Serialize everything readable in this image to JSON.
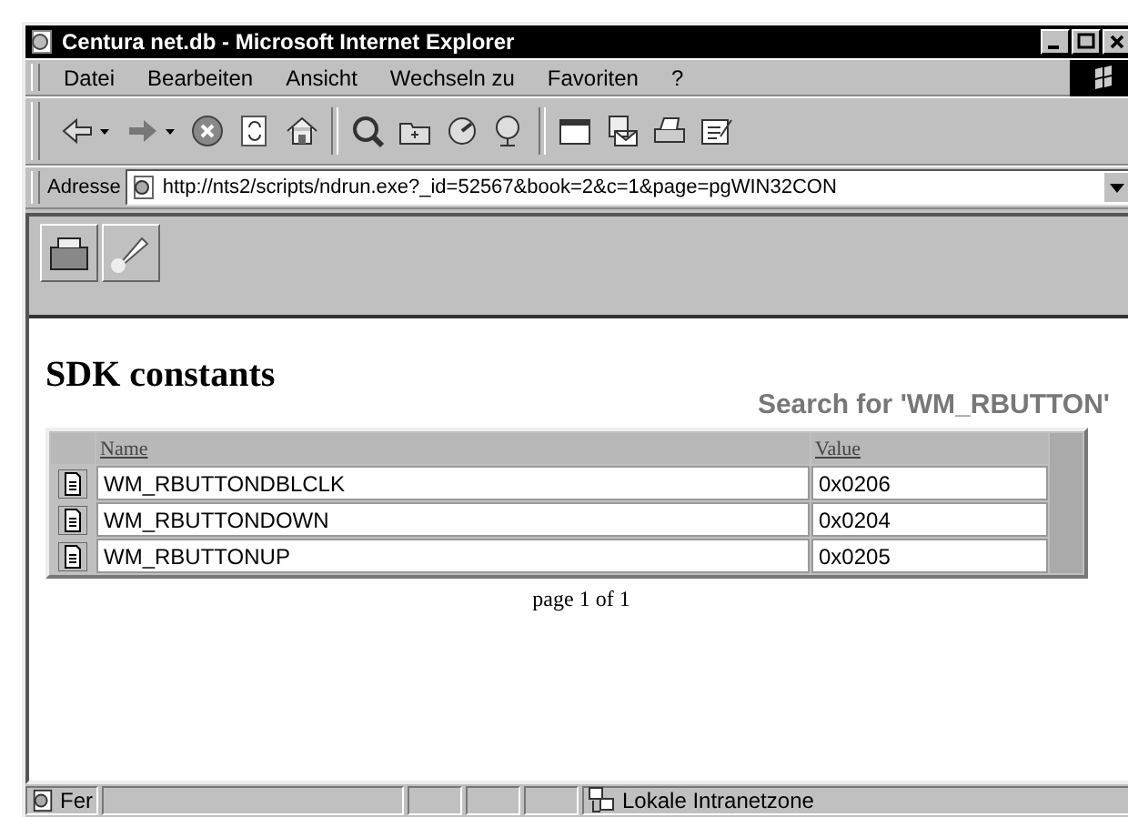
{
  "window": {
    "title": "Centura net.db - Microsoft Internet Explorer"
  },
  "menu": [
    "Datei",
    "Bearbeiten",
    "Ansicht",
    "Wechseln zu",
    "Favoriten",
    "?"
  ],
  "address": {
    "label": "Adresse",
    "value": "http://nts2/scripts/ndrun.exe?_id=52567&book=2&c=1&page=pgWIN32CON"
  },
  "page": {
    "heading": "SDK constants",
    "search_caption": "Search for 'WM_RBUTTON'",
    "table": {
      "columns": [
        "Name",
        "Value"
      ],
      "rows": [
        {
          "name": "WM_RBUTTONDBLCLK",
          "value": "0x0206"
        },
        {
          "name": "WM_RBUTTONDOWN",
          "value": "0x0204"
        },
        {
          "name": "WM_RBUTTONUP",
          "value": "0x0205"
        }
      ]
    },
    "pager": "page 1 of 1"
  },
  "status_bar": {
    "text": "Fer",
    "zone": "Lokale Intranetzone"
  }
}
